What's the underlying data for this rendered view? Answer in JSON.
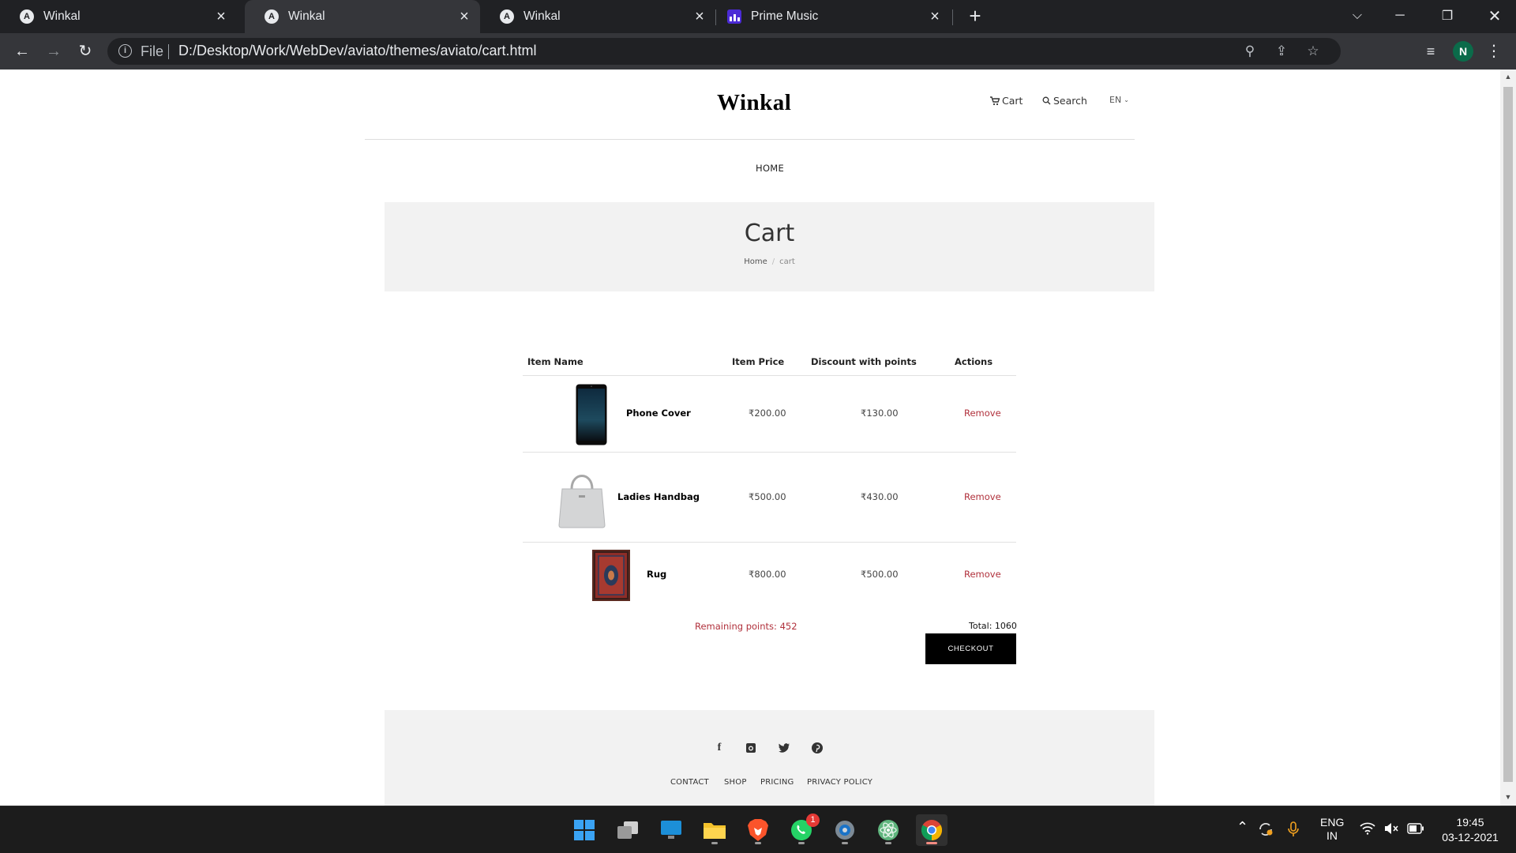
{
  "browser": {
    "tabs": [
      {
        "title": "Winkal",
        "favicon": "A"
      },
      {
        "title": "Winkal",
        "favicon": "A"
      },
      {
        "title": "Winkal",
        "favicon": "A"
      },
      {
        "title": "Prime Music",
        "favicon": "prime-music-icon"
      }
    ],
    "active_tab": 1,
    "address": {
      "scheme_label": "File",
      "url": "D:/Desktop/Work/WebDev/aviato/themes/aviato/cart.html"
    },
    "profile_initial": "N"
  },
  "site": {
    "logo": "Winkal",
    "nav": {
      "cart": "Cart",
      "search": "Search",
      "lang": "EN"
    },
    "menu_home": "HOME"
  },
  "hero": {
    "title": "Cart",
    "breadcrumb": {
      "home": "Home",
      "sep": "/",
      "current": "cart"
    }
  },
  "cart": {
    "headers": {
      "item": "Item Name",
      "price": "Item Price",
      "discount": "Discount with points",
      "actions": "Actions"
    },
    "items": [
      {
        "name": "Phone Cover",
        "price": "₹200.00",
        "discount": "₹130.00",
        "action": "Remove",
        "image": "phone-cover-image"
      },
      {
        "name": "Ladies Handbag",
        "price": "₹500.00",
        "discount": "₹430.00",
        "action": "Remove",
        "image": "handbag-image"
      },
      {
        "name": "Rug",
        "price": "₹800.00",
        "discount": "₹500.00",
        "action": "Remove",
        "image": "rug-image"
      }
    ],
    "remaining_points": "Remaining points: 452",
    "total": "Total: 1060",
    "checkout": "CHECKOUT"
  },
  "footer": {
    "social": [
      "f",
      "instagram",
      "twitter",
      "pinterest"
    ],
    "links": [
      "CONTACT",
      "SHOP",
      "PRICING",
      "PRIVACY POLICY"
    ]
  },
  "taskbar": {
    "whatsapp_badge": "1",
    "lang_top": "ENG",
    "lang_bottom": "IN",
    "time": "19:45",
    "date": "03-12-2021"
  },
  "colors": {
    "accent_red": "#b0303b",
    "chrome_dark": "#202124",
    "chrome_tab": "#35363a"
  }
}
